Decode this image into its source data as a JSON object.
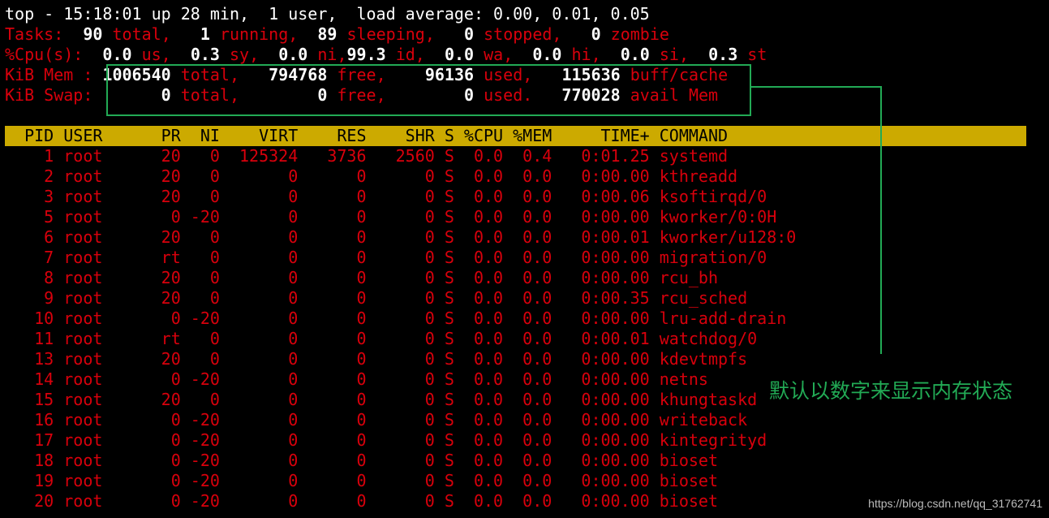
{
  "summary": {
    "uptime_line": "top - 15:18:01 up 28 min,  1 user,  load average: 0.00, 0.01, 0.05",
    "tasks": {
      "label": "Tasks:",
      "total": "90",
      "total_label": "total,",
      "running": "1",
      "running_label": "running,",
      "sleeping": "89",
      "sleeping_label": "sleeping,",
      "stopped": "0",
      "stopped_label": "stopped,",
      "zombie": "0",
      "zombie_label": "zombie"
    },
    "cpu": {
      "label": "%Cpu(s):",
      "us": "0.0",
      "us_label": "us,",
      "sy": "0.3",
      "sy_label": "sy,",
      "ni": "0.0",
      "ni_label": "ni,",
      "id": "99.3",
      "id_label": "id,",
      "wa": "0.0",
      "wa_label": "wa,",
      "hi": "0.0",
      "hi_label": "hi,",
      "si": "0.0",
      "si_label": "si,",
      "st": "0.3",
      "st_label": "st"
    },
    "mem": {
      "label": "KiB Mem :",
      "total": "1006540",
      "total_label": "total,",
      "free": "794768",
      "free_label": "free,",
      "used": "96136",
      "used_label": "used,",
      "buff": "115636",
      "buff_label": "buff/cache"
    },
    "swap": {
      "label": "KiB Swap:",
      "total": "0",
      "total_label": "total,",
      "free": "0",
      "free_label": "free,",
      "used": "0",
      "used_label": "used.",
      "avail": "770028",
      "avail_label": "avail Mem"
    }
  },
  "table": {
    "header": "  PID USER      PR  NI    VIRT    RES    SHR S %CPU %MEM     TIME+ COMMAND",
    "rows": [
      "    1 root      20   0  125324   3736   2560 S  0.0  0.4   0:01.25 systemd",
      "    2 root      20   0       0      0      0 S  0.0  0.0   0:00.00 kthreadd",
      "    3 root      20   0       0      0      0 S  0.0  0.0   0:00.06 ksoftirqd/0",
      "    5 root       0 -20       0      0      0 S  0.0  0.0   0:00.00 kworker/0:0H",
      "    6 root      20   0       0      0      0 S  0.0  0.0   0:00.01 kworker/u128:0",
      "    7 root      rt   0       0      0      0 S  0.0  0.0   0:00.00 migration/0",
      "    8 root      20   0       0      0      0 S  0.0  0.0   0:00.00 rcu_bh",
      "    9 root      20   0       0      0      0 S  0.0  0.0   0:00.35 rcu_sched",
      "   10 root       0 -20       0      0      0 S  0.0  0.0   0:00.00 lru-add-drain",
      "   11 root      rt   0       0      0      0 S  0.0  0.0   0:00.01 watchdog/0",
      "   13 root      20   0       0      0      0 S  0.0  0.0   0:00.00 kdevtmpfs",
      "   14 root       0 -20       0      0      0 S  0.0  0.0   0:00.00 netns",
      "   15 root      20   0       0      0      0 S  0.0  0.0   0:00.00 khungtaskd",
      "   16 root       0 -20       0      0      0 S  0.0  0.0   0:00.00 writeback",
      "   17 root       0 -20       0      0      0 S  0.0  0.0   0:00.00 kintegrityd",
      "   18 root       0 -20       0      0      0 S  0.0  0.0   0:00.00 bioset",
      "   19 root       0 -20       0      0      0 S  0.0  0.0   0:00.00 bioset",
      "   20 root       0 -20       0      0      0 S  0.0  0.0   0:00.00 bioset"
    ]
  },
  "annotation": "默认以数字来显示内存状态",
  "watermark": "https://blog.csdn.net/qq_31762741",
  "colors": {
    "label": "#d8000c",
    "header_bg": "#ccaa00",
    "annotation": "#22aa55"
  }
}
